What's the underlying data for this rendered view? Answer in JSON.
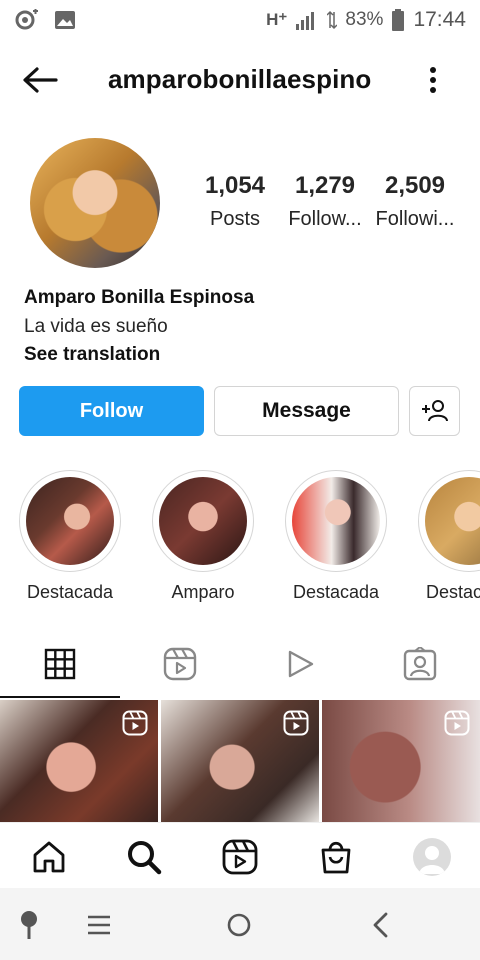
{
  "status_bar": {
    "network": "H⁺",
    "battery_percent": "83%",
    "time": "17:44"
  },
  "header": {
    "username": "amparobonillaespino"
  },
  "profile": {
    "stats": [
      {
        "value": "1,054",
        "label": "Posts"
      },
      {
        "value": "1,279",
        "label": "Follow..."
      },
      {
        "value": "2,509",
        "label": "Followi..."
      }
    ],
    "name": "Amparo Bonilla Espinosa",
    "bio": "La vida es sueño",
    "translate_link": "See translation"
  },
  "actions": {
    "follow_label": "Follow",
    "message_label": "Message"
  },
  "highlights": [
    {
      "label": "Destacada"
    },
    {
      "label": "Amparo"
    },
    {
      "label": "Destacada"
    },
    {
      "label": "Destac"
    }
  ],
  "tabs": [
    {
      "icon": "grid-icon",
      "active": true
    },
    {
      "icon": "reels-icon",
      "active": false
    },
    {
      "icon": "video-icon",
      "active": false
    },
    {
      "icon": "tagged-icon",
      "active": false
    }
  ],
  "grid_posts": [
    {
      "type": "reel"
    },
    {
      "type": "reel"
    },
    {
      "type": "reel"
    }
  ],
  "bottom_nav": [
    "home-icon",
    "search-icon",
    "reels-icon",
    "shop-icon",
    "profile-avatar"
  ],
  "colors": {
    "follow_button": "#1d9bf0",
    "text": "#262626"
  }
}
